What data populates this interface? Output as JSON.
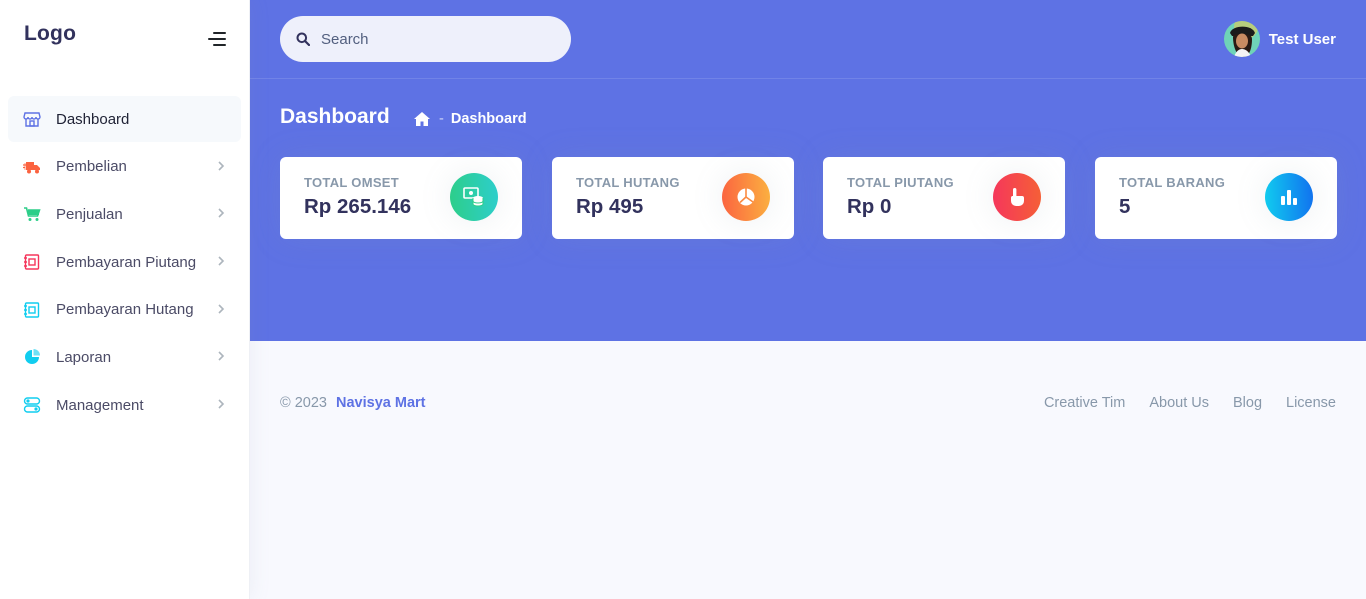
{
  "sidebar": {
    "brand": "Logo",
    "items": [
      {
        "label": "Dashboard",
        "icon": "shop-icon",
        "color": "#5e72e4",
        "active": true
      },
      {
        "label": "Pembelian",
        "icon": "delivery-truck-icon",
        "color": "#fb6340"
      },
      {
        "label": "Penjualan",
        "icon": "cart-icon",
        "color": "#2dce89"
      },
      {
        "label": "Pembayaran Piutang",
        "icon": "receipt-icon",
        "color": "#f5365c"
      },
      {
        "label": "Pembayaran Hutang",
        "icon": "receipt-icon",
        "color": "#11cdef"
      },
      {
        "label": "Laporan",
        "icon": "pie-chart-icon",
        "color": "#11cdef"
      },
      {
        "label": "Management",
        "icon": "settings-icon",
        "color": "#11cdef"
      }
    ]
  },
  "header": {
    "search_placeholder": "Search",
    "user_name": "Test User",
    "page_title": "Dashboard",
    "breadcrumb_separator": "-",
    "breadcrumb_current": "Dashboard"
  },
  "cards": [
    {
      "label": "TOTAL OMSET",
      "value": "Rp 265.146",
      "icon": "money-coins-icon",
      "gradient": [
        "#2dce89",
        "#2dcecc"
      ]
    },
    {
      "label": "TOTAL HUTANG",
      "value": "Rp 495",
      "icon": "pie-chart-icon",
      "gradient": [
        "#fb6340",
        "#fbb140"
      ]
    },
    {
      "label": "TOTAL PIUTANG",
      "value": "Rp 0",
      "icon": "hand-pointer-icon",
      "gradient": [
        "#f5365c",
        "#f56036"
      ]
    },
    {
      "label": "TOTAL BARANG",
      "value": "5",
      "icon": "bar-chart-icon",
      "gradient": [
        "#11cdef",
        "#1171ef"
      ]
    }
  ],
  "footer": {
    "copyright": "© 2023",
    "brand": "Navisya Mart",
    "links": [
      "Creative Tim",
      "About Us",
      "Blog",
      "License"
    ]
  },
  "colors": {
    "primary": "#5e72e4",
    "background": "#f8f9fe"
  }
}
